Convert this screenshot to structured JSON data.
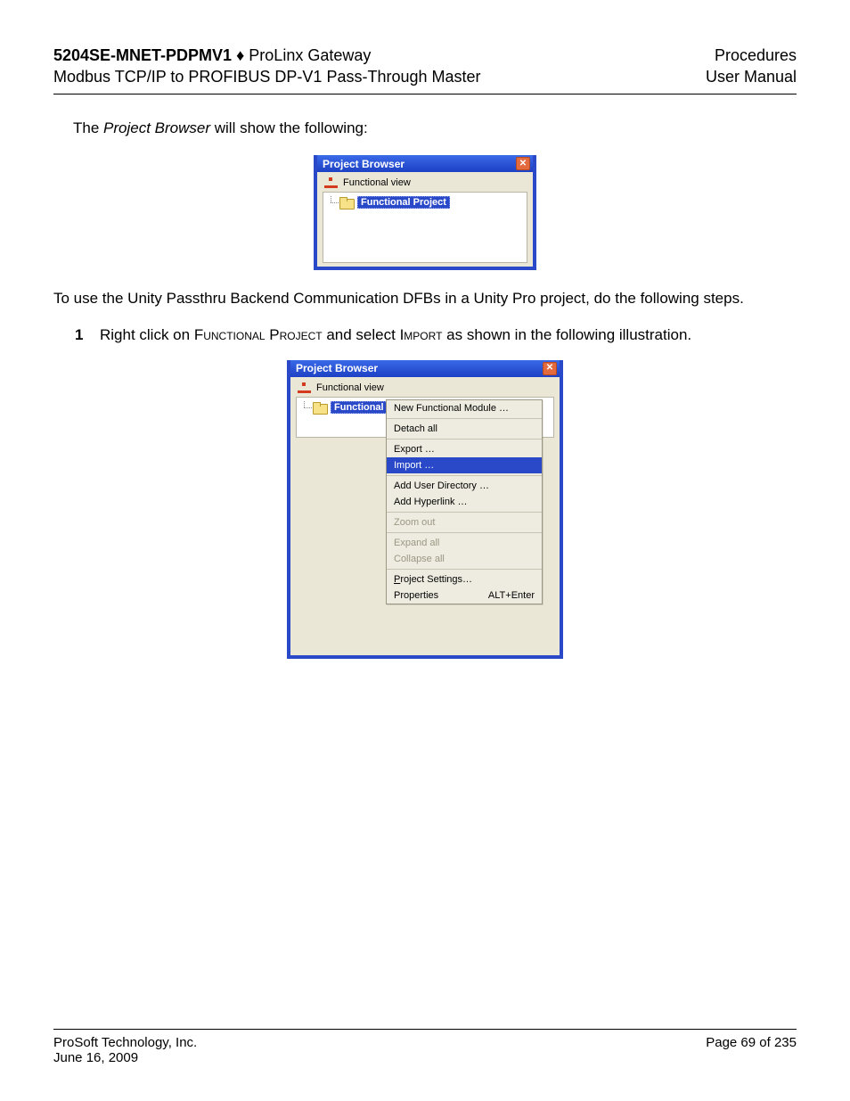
{
  "header": {
    "left_bold": "5204SE-MNET-PDPMV1",
    "left_separator": "♦",
    "left_rest": "ProLinx Gateway",
    "left_line2": "Modbus TCP/IP to PROFIBUS DP-V1 Pass-Through Master",
    "right_line1": "Procedures",
    "right_line2": "User Manual"
  },
  "para1_prefix": "The ",
  "para1_italic": "Project Browser",
  "para1_rest": " will show the following:",
  "panel1": {
    "title": "Project Browser",
    "root_label": "Functional view",
    "sel_label": "Functional Project"
  },
  "para2": "To use the Unity Passthru Backend Communication DFBs in a Unity Pro project, do the following steps.",
  "step": {
    "num": "1",
    "text_prefix": "Right click on ",
    "text_bold1": "Functional Project",
    "text_mid": " and select ",
    "text_bold2": "Import",
    "text_suffix": " as shown in the following illustration."
  },
  "panel2": {
    "title": "Project Browser",
    "root_label": "Functional view",
    "sel_label": "Functional Project",
    "menu": {
      "new_module": "New Functional Module …",
      "detach_all": "Detach all",
      "export": "Export …",
      "import": "Import …",
      "add_user_dir": "Add User Directory …",
      "add_hyperlink": "Add Hyperlink …",
      "zoom_out": "Zoom out",
      "expand_all": "Expand all",
      "collapse_all": "Collapse all",
      "project_settings_u": "P",
      "project_settings_rest": "roject Settings…",
      "properties": "Properties",
      "properties_accel": "ALT+Enter"
    }
  },
  "footer": {
    "left_line1": "ProSoft Technology, Inc.",
    "left_line2": "June 16, 2009",
    "right": "Page 69 of 235"
  }
}
